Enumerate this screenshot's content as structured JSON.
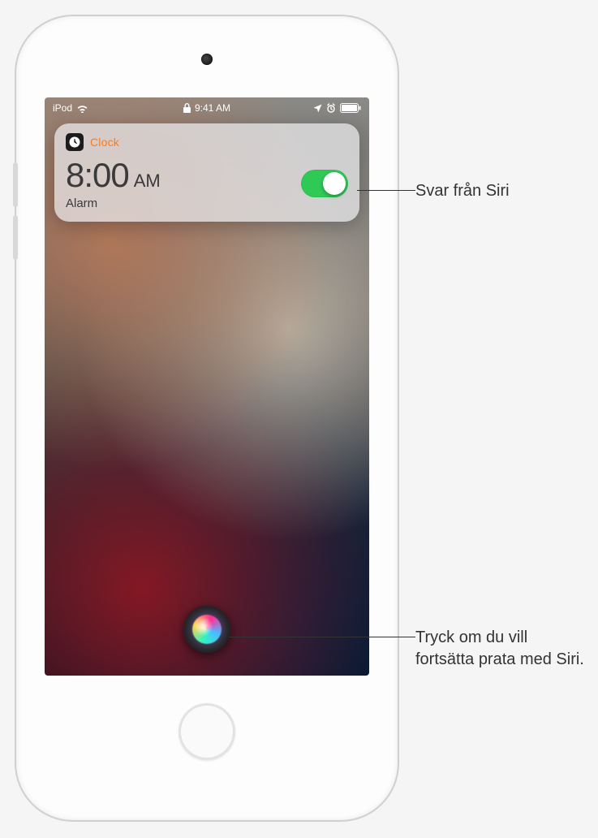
{
  "status_bar": {
    "carrier": "iPod",
    "time": "9:41 AM"
  },
  "notification": {
    "app_name": "Clock",
    "alarm_time": "8:00",
    "alarm_ampm": "AM",
    "alarm_label": "Alarm",
    "toggle_on": true
  },
  "callouts": {
    "siri_response": "Svar från Siri",
    "siri_continue": "Tryck om du vill fortsätta prata med Siri."
  }
}
